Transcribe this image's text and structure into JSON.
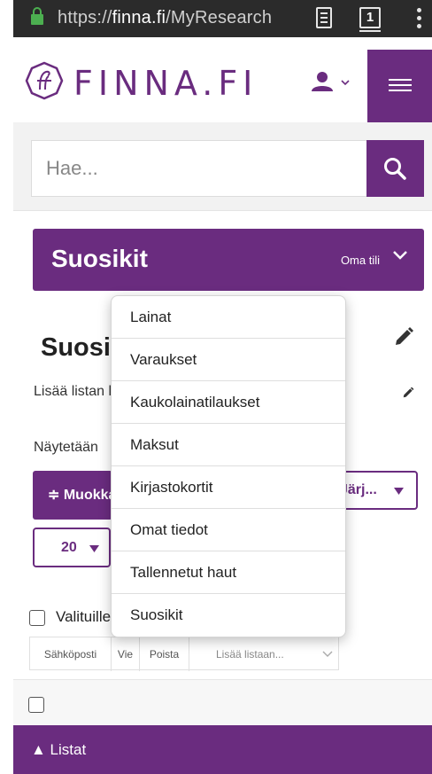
{
  "browser": {
    "url_scheme": "https://",
    "url_host": "finna.fi",
    "url_path": "/MyResearch",
    "tab_count": "1"
  },
  "header": {
    "logo_text": "FINNA.FI",
    "brand_color": "#6a2c7f"
  },
  "search": {
    "placeholder": "Hae..."
  },
  "account_bar": {
    "title": "Suosikit",
    "label": "Oma tili"
  },
  "main": {
    "title": "Suosikit",
    "description": "Lisää listan kuvaus",
    "showing": "Näytetään",
    "edit_button": "≑ Muokkaa",
    "sort_label": "Järj...",
    "limit_value": "20",
    "selected_label": "Valituille"
  },
  "bulk_actions": [
    "Sähköposti",
    "Vie",
    "Poista",
    "Lisää listaan..."
  ],
  "footer": {
    "label": "▲ Listat"
  },
  "dropdown": {
    "items": [
      "Lainat",
      "Varaukset",
      "Kaukolainatilaukset",
      "Maksut",
      "Kirjastokortit",
      "Omat tiedot",
      "Tallennetut haut",
      "Suosikit"
    ]
  }
}
